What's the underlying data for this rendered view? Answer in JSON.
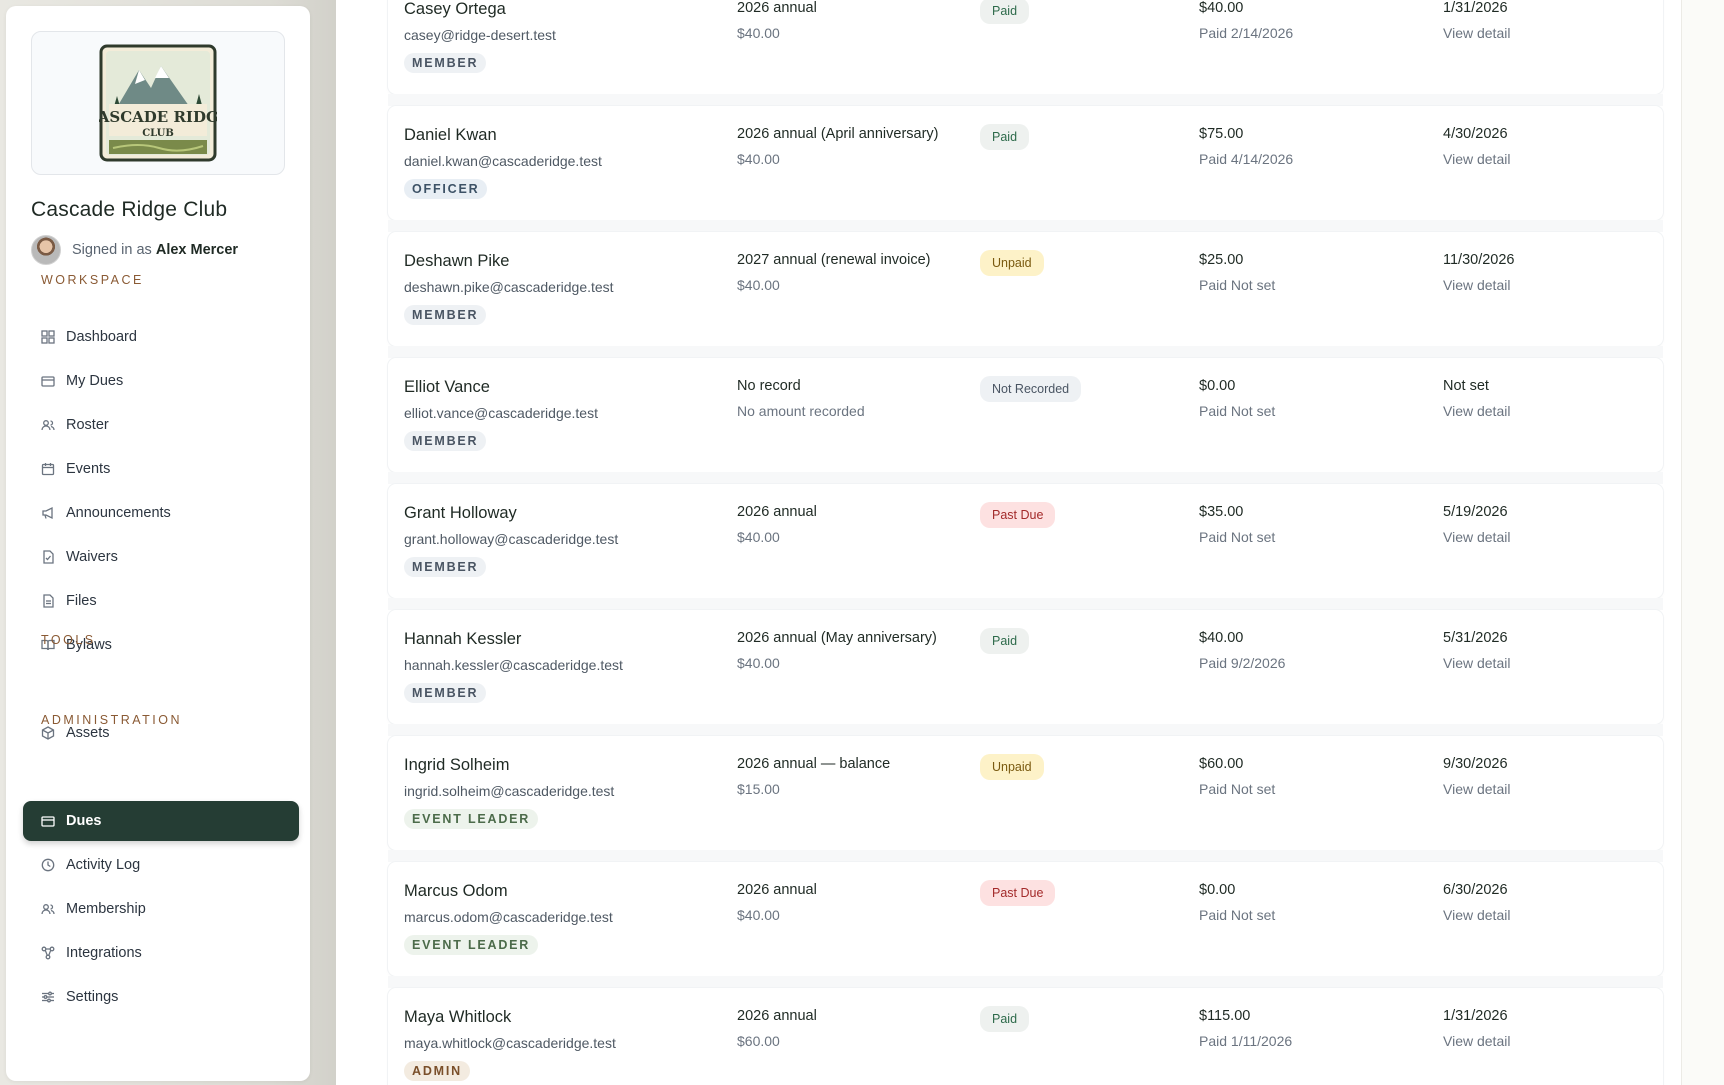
{
  "club": {
    "name": "Cascade Ridge Club",
    "logo_text": "CASCADE RIDGE",
    "logo_sub": "CLUB"
  },
  "user": {
    "signed_in_prefix": "Signed in as",
    "name": "Alex Mercer"
  },
  "sections": {
    "workspace": "WORKSPACE",
    "tools": "TOOLS",
    "administration": "ADMINISTRATION"
  },
  "nav": {
    "workspace": [
      {
        "label": "Dashboard",
        "icon": "grid-icon"
      },
      {
        "label": "My Dues",
        "icon": "card-icon"
      },
      {
        "label": "Roster",
        "icon": "users-icon"
      },
      {
        "label": "Events",
        "icon": "calendar-icon"
      },
      {
        "label": "Announcements",
        "icon": "megaphone-icon"
      },
      {
        "label": "Waivers",
        "icon": "document-icon"
      },
      {
        "label": "Files",
        "icon": "file-icon"
      },
      {
        "label": "Bylaws",
        "icon": "book-icon"
      }
    ],
    "tools": [
      {
        "label": "Assets",
        "icon": "box-icon"
      }
    ],
    "administration": [
      {
        "label": "Dues",
        "icon": "card-icon",
        "active": true
      },
      {
        "label": "Activity Log",
        "icon": "clock-icon"
      },
      {
        "label": "Membership",
        "icon": "users-icon"
      },
      {
        "label": "Integrations",
        "icon": "network-icon"
      },
      {
        "label": "Settings",
        "icon": "sliders-icon"
      }
    ]
  },
  "rows": [
    {
      "name": "Casey Ortega",
      "email": "casey@ridge-desert.test",
      "role": "MEMBER",
      "role_class": "member",
      "period": "2026 annual",
      "period_amount": "$40.00",
      "status": "Paid",
      "status_class": "paid",
      "paid_amount": "$40.00",
      "paid_date": "Paid 2/14/2026",
      "due": "1/31/2026",
      "link": "View detail"
    },
    {
      "name": "Daniel Kwan",
      "email": "daniel.kwan@cascaderidge.test",
      "role": "OFFICER",
      "role_class": "officer",
      "period": "2026 annual (April anniversary)",
      "period_amount": "$40.00",
      "status": "Paid",
      "status_class": "paid",
      "paid_amount": "$75.00",
      "paid_date": "Paid 4/14/2026",
      "due": "4/30/2026",
      "link": "View detail"
    },
    {
      "name": "Deshawn Pike",
      "email": "deshawn.pike@cascaderidge.test",
      "role": "MEMBER",
      "role_class": "member",
      "period": "2027 annual (renewal invoice)",
      "period_amount": "$40.00",
      "status": "Unpaid",
      "status_class": "unpaid",
      "paid_amount": "$25.00",
      "paid_date": "Paid Not set",
      "due": "11/30/2026",
      "link": "View detail"
    },
    {
      "name": "Elliot Vance",
      "email": "elliot.vance@cascaderidge.test",
      "role": "MEMBER",
      "role_class": "member",
      "period": "No record",
      "period_amount": "No amount recorded",
      "status": "Not Recorded",
      "status_class": "not-recorded",
      "paid_amount": "$0.00",
      "paid_date": "Paid Not set",
      "due": "Not set",
      "link": "View detail"
    },
    {
      "name": "Grant Holloway",
      "email": "grant.holloway@cascaderidge.test",
      "role": "MEMBER",
      "role_class": "member",
      "period": "2026 annual",
      "period_amount": "$40.00",
      "status": "Past Due",
      "status_class": "past-due",
      "paid_amount": "$35.00",
      "paid_date": "Paid Not set",
      "due": "5/19/2026",
      "link": "View detail"
    },
    {
      "name": "Hannah Kessler",
      "email": "hannah.kessler@cascaderidge.test",
      "role": "MEMBER",
      "role_class": "member",
      "period": "2026 annual (May anniversary)",
      "period_amount": "$40.00",
      "status": "Paid",
      "status_class": "paid",
      "paid_amount": "$40.00",
      "paid_date": "Paid 9/2/2026",
      "due": "5/31/2026",
      "link": "View detail"
    },
    {
      "name": "Ingrid Solheim",
      "email": "ingrid.solheim@cascaderidge.test",
      "role": "EVENT LEADER",
      "role_class": "event-leader",
      "period": "2026 annual — balance",
      "period_amount": "$15.00",
      "status": "Unpaid",
      "status_class": "unpaid",
      "paid_amount": "$60.00",
      "paid_date": "Paid Not set",
      "due": "9/30/2026",
      "link": "View detail"
    },
    {
      "name": "Marcus Odom",
      "email": "marcus.odom@cascaderidge.test",
      "role": "EVENT LEADER",
      "role_class": "event-leader",
      "period": "2026 annual",
      "period_amount": "$40.00",
      "status": "Past Due",
      "status_class": "past-due",
      "paid_amount": "$0.00",
      "paid_date": "Paid Not set",
      "due": "6/30/2026",
      "link": "View detail"
    },
    {
      "name": "Maya Whitlock",
      "email": "maya.whitlock@cascaderidge.test",
      "role": "ADMIN",
      "role_class": "admin",
      "period": "2026 annual",
      "period_amount": "$60.00",
      "status": "Paid",
      "status_class": "paid",
      "paid_amount": "$115.00",
      "paid_date": "Paid 1/11/2026",
      "due": "1/31/2026",
      "link": "View detail"
    }
  ]
}
